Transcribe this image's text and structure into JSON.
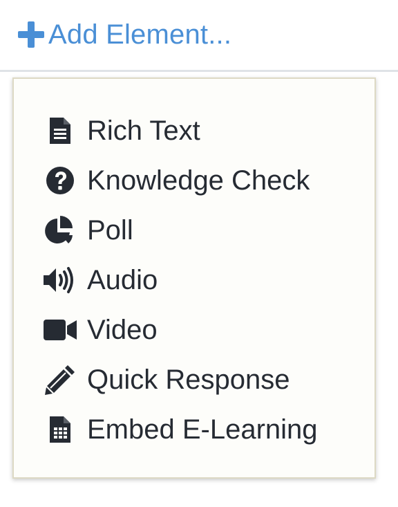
{
  "header": {
    "add_element_label": "Add Element...",
    "accent_color": "#4a8fd6"
  },
  "menu": {
    "items": [
      {
        "label": "Rich Text",
        "icon": "file-text-icon"
      },
      {
        "label": "Knowledge Check",
        "icon": "question-circle-icon"
      },
      {
        "label": "Poll",
        "icon": "pie-chart-icon"
      },
      {
        "label": "Audio",
        "icon": "volume-icon"
      },
      {
        "label": "Video",
        "icon": "video-camera-icon"
      },
      {
        "label": "Quick Response",
        "icon": "pencil-icon"
      },
      {
        "label": "Embed E-Learning",
        "icon": "file-grid-icon"
      }
    ],
    "text_color": "#262b33"
  }
}
